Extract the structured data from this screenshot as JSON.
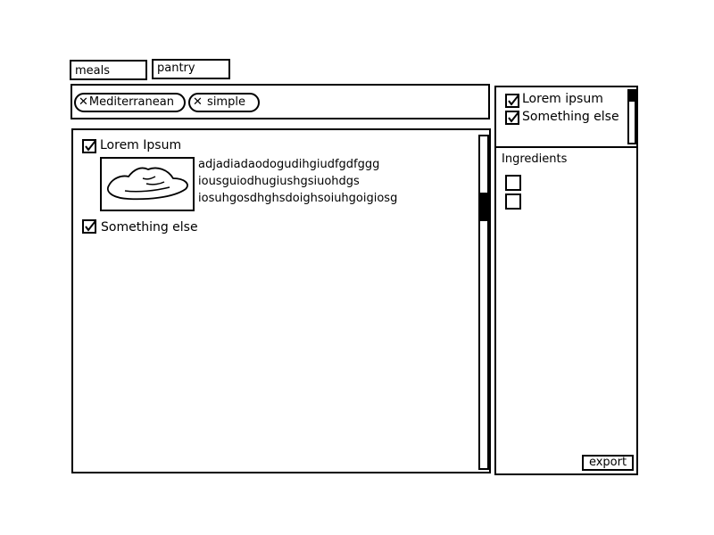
{
  "tabs": [
    {
      "label": "meals"
    },
    {
      "label": "pantry"
    }
  ],
  "filters": {
    "chips": [
      {
        "label": "Mediterranean",
        "remove_icon": "close-icon"
      },
      {
        "label": "simple",
        "remove_icon": "close-icon"
      }
    ]
  },
  "meals": [
    {
      "title": "Lorem Ipsum",
      "checked": true,
      "thumbnail_icon": "food-image-icon",
      "description_lines": [
        "adjadiadaodogudihgiudfgdfggg",
        "iousguiodhugiushgsiuohdgs",
        "iosuhgosdhghsdoighsoiuhgoigiosg"
      ]
    },
    {
      "title": "Something else",
      "checked": true
    }
  ],
  "selected": {
    "items": [
      {
        "label": "Lorem ipsum",
        "checked": true
      },
      {
        "label": "Something else",
        "checked": true
      }
    ]
  },
  "ingredients": {
    "title": "Ingredients",
    "items": [
      {
        "checked": false
      },
      {
        "checked": false
      }
    ]
  },
  "export_label": "export"
}
